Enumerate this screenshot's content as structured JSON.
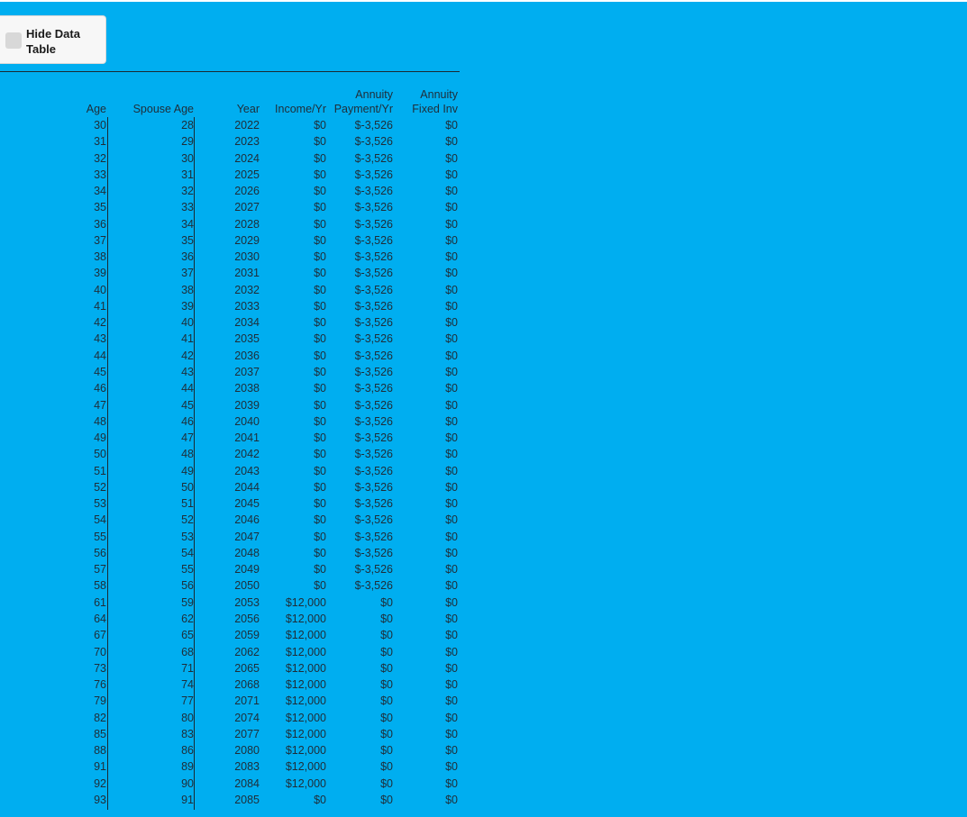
{
  "toggle": {
    "label": "Hide Data Table"
  },
  "table": {
    "headers": {
      "age": "Age",
      "spouse_age": "Spouse Age",
      "year": "Year",
      "income": "Income/Yr",
      "payment_l1": "Annuity",
      "payment_l2": "Payment/Yr",
      "fixed_l1": "Annuity",
      "fixed_l2": "Fixed Inv"
    },
    "rows": [
      {
        "age": "30",
        "spouse_age": "28",
        "year": "2022",
        "income": "$0",
        "payment": "$-3,526",
        "fixed": "$0"
      },
      {
        "age": "31",
        "spouse_age": "29",
        "year": "2023",
        "income": "$0",
        "payment": "$-3,526",
        "fixed": "$0"
      },
      {
        "age": "32",
        "spouse_age": "30",
        "year": "2024",
        "income": "$0",
        "payment": "$-3,526",
        "fixed": "$0"
      },
      {
        "age": "33",
        "spouse_age": "31",
        "year": "2025",
        "income": "$0",
        "payment": "$-3,526",
        "fixed": "$0"
      },
      {
        "age": "34",
        "spouse_age": "32",
        "year": "2026",
        "income": "$0",
        "payment": "$-3,526",
        "fixed": "$0"
      },
      {
        "age": "35",
        "spouse_age": "33",
        "year": "2027",
        "income": "$0",
        "payment": "$-3,526",
        "fixed": "$0"
      },
      {
        "age": "36",
        "spouse_age": "34",
        "year": "2028",
        "income": "$0",
        "payment": "$-3,526",
        "fixed": "$0"
      },
      {
        "age": "37",
        "spouse_age": "35",
        "year": "2029",
        "income": "$0",
        "payment": "$-3,526",
        "fixed": "$0"
      },
      {
        "age": "38",
        "spouse_age": "36",
        "year": "2030",
        "income": "$0",
        "payment": "$-3,526",
        "fixed": "$0"
      },
      {
        "age": "39",
        "spouse_age": "37",
        "year": "2031",
        "income": "$0",
        "payment": "$-3,526",
        "fixed": "$0"
      },
      {
        "age": "40",
        "spouse_age": "38",
        "year": "2032",
        "income": "$0",
        "payment": "$-3,526",
        "fixed": "$0"
      },
      {
        "age": "41",
        "spouse_age": "39",
        "year": "2033",
        "income": "$0",
        "payment": "$-3,526",
        "fixed": "$0"
      },
      {
        "age": "42",
        "spouse_age": "40",
        "year": "2034",
        "income": "$0",
        "payment": "$-3,526",
        "fixed": "$0"
      },
      {
        "age": "43",
        "spouse_age": "41",
        "year": "2035",
        "income": "$0",
        "payment": "$-3,526",
        "fixed": "$0"
      },
      {
        "age": "44",
        "spouse_age": "42",
        "year": "2036",
        "income": "$0",
        "payment": "$-3,526",
        "fixed": "$0"
      },
      {
        "age": "45",
        "spouse_age": "43",
        "year": "2037",
        "income": "$0",
        "payment": "$-3,526",
        "fixed": "$0"
      },
      {
        "age": "46",
        "spouse_age": "44",
        "year": "2038",
        "income": "$0",
        "payment": "$-3,526",
        "fixed": "$0"
      },
      {
        "age": "47",
        "spouse_age": "45",
        "year": "2039",
        "income": "$0",
        "payment": "$-3,526",
        "fixed": "$0"
      },
      {
        "age": "48",
        "spouse_age": "46",
        "year": "2040",
        "income": "$0",
        "payment": "$-3,526",
        "fixed": "$0"
      },
      {
        "age": "49",
        "spouse_age": "47",
        "year": "2041",
        "income": "$0",
        "payment": "$-3,526",
        "fixed": "$0"
      },
      {
        "age": "50",
        "spouse_age": "48",
        "year": "2042",
        "income": "$0",
        "payment": "$-3,526",
        "fixed": "$0"
      },
      {
        "age": "51",
        "spouse_age": "49",
        "year": "2043",
        "income": "$0",
        "payment": "$-3,526",
        "fixed": "$0"
      },
      {
        "age": "52",
        "spouse_age": "50",
        "year": "2044",
        "income": "$0",
        "payment": "$-3,526",
        "fixed": "$0"
      },
      {
        "age": "53",
        "spouse_age": "51",
        "year": "2045",
        "income": "$0",
        "payment": "$-3,526",
        "fixed": "$0"
      },
      {
        "age": "54",
        "spouse_age": "52",
        "year": "2046",
        "income": "$0",
        "payment": "$-3,526",
        "fixed": "$0"
      },
      {
        "age": "55",
        "spouse_age": "53",
        "year": "2047",
        "income": "$0",
        "payment": "$-3,526",
        "fixed": "$0"
      },
      {
        "age": "56",
        "spouse_age": "54",
        "year": "2048",
        "income": "$0",
        "payment": "$-3,526",
        "fixed": "$0"
      },
      {
        "age": "57",
        "spouse_age": "55",
        "year": "2049",
        "income": "$0",
        "payment": "$-3,526",
        "fixed": "$0"
      },
      {
        "age": "58",
        "spouse_age": "56",
        "year": "2050",
        "income": "$0",
        "payment": "$-3,526",
        "fixed": "$0"
      },
      {
        "age": "61",
        "spouse_age": "59",
        "year": "2053",
        "income": "$12,000",
        "payment": "$0",
        "fixed": "$0"
      },
      {
        "age": "64",
        "spouse_age": "62",
        "year": "2056",
        "income": "$12,000",
        "payment": "$0",
        "fixed": "$0"
      },
      {
        "age": "67",
        "spouse_age": "65",
        "year": "2059",
        "income": "$12,000",
        "payment": "$0",
        "fixed": "$0"
      },
      {
        "age": "70",
        "spouse_age": "68",
        "year": "2062",
        "income": "$12,000",
        "payment": "$0",
        "fixed": "$0"
      },
      {
        "age": "73",
        "spouse_age": "71",
        "year": "2065",
        "income": "$12,000",
        "payment": "$0",
        "fixed": "$0"
      },
      {
        "age": "76",
        "spouse_age": "74",
        "year": "2068",
        "income": "$12,000",
        "payment": "$0",
        "fixed": "$0"
      },
      {
        "age": "79",
        "spouse_age": "77",
        "year": "2071",
        "income": "$12,000",
        "payment": "$0",
        "fixed": "$0"
      },
      {
        "age": "82",
        "spouse_age": "80",
        "year": "2074",
        "income": "$12,000",
        "payment": "$0",
        "fixed": "$0"
      },
      {
        "age": "85",
        "spouse_age": "83",
        "year": "2077",
        "income": "$12,000",
        "payment": "$0",
        "fixed": "$0"
      },
      {
        "age": "88",
        "spouse_age": "86",
        "year": "2080",
        "income": "$12,000",
        "payment": "$0",
        "fixed": "$0"
      },
      {
        "age": "91",
        "spouse_age": "89",
        "year": "2083",
        "income": "$12,000",
        "payment": "$0",
        "fixed": "$0"
      },
      {
        "age": "92",
        "spouse_age": "90",
        "year": "2084",
        "income": "$12,000",
        "payment": "$0",
        "fixed": "$0"
      },
      {
        "age": "93",
        "spouse_age": "91",
        "year": "2085",
        "income": "$0",
        "payment": "$0",
        "fixed": "$0"
      }
    ]
  }
}
